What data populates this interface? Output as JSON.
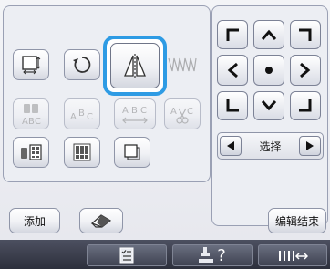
{
  "buttons": {
    "add_label": "添加",
    "end_edit_label": "编辑结束"
  },
  "select_bar": {
    "label": "选择"
  },
  "edit_tools": [
    "resize-icon",
    "rotate-icon",
    "mirror-icon",
    "density-icon",
    "array-icon",
    "curve-text-icon",
    "spacing-icon",
    "character-edit-icon",
    "embroidery-order-icon",
    "multi-color-icon",
    "border-icon"
  ],
  "selected_tool": "mirror-icon",
  "taskbar": {
    "items": [
      "checklist-icon",
      "help-icon",
      "thread-tension-icon"
    ],
    "help_glyph": "?"
  }
}
